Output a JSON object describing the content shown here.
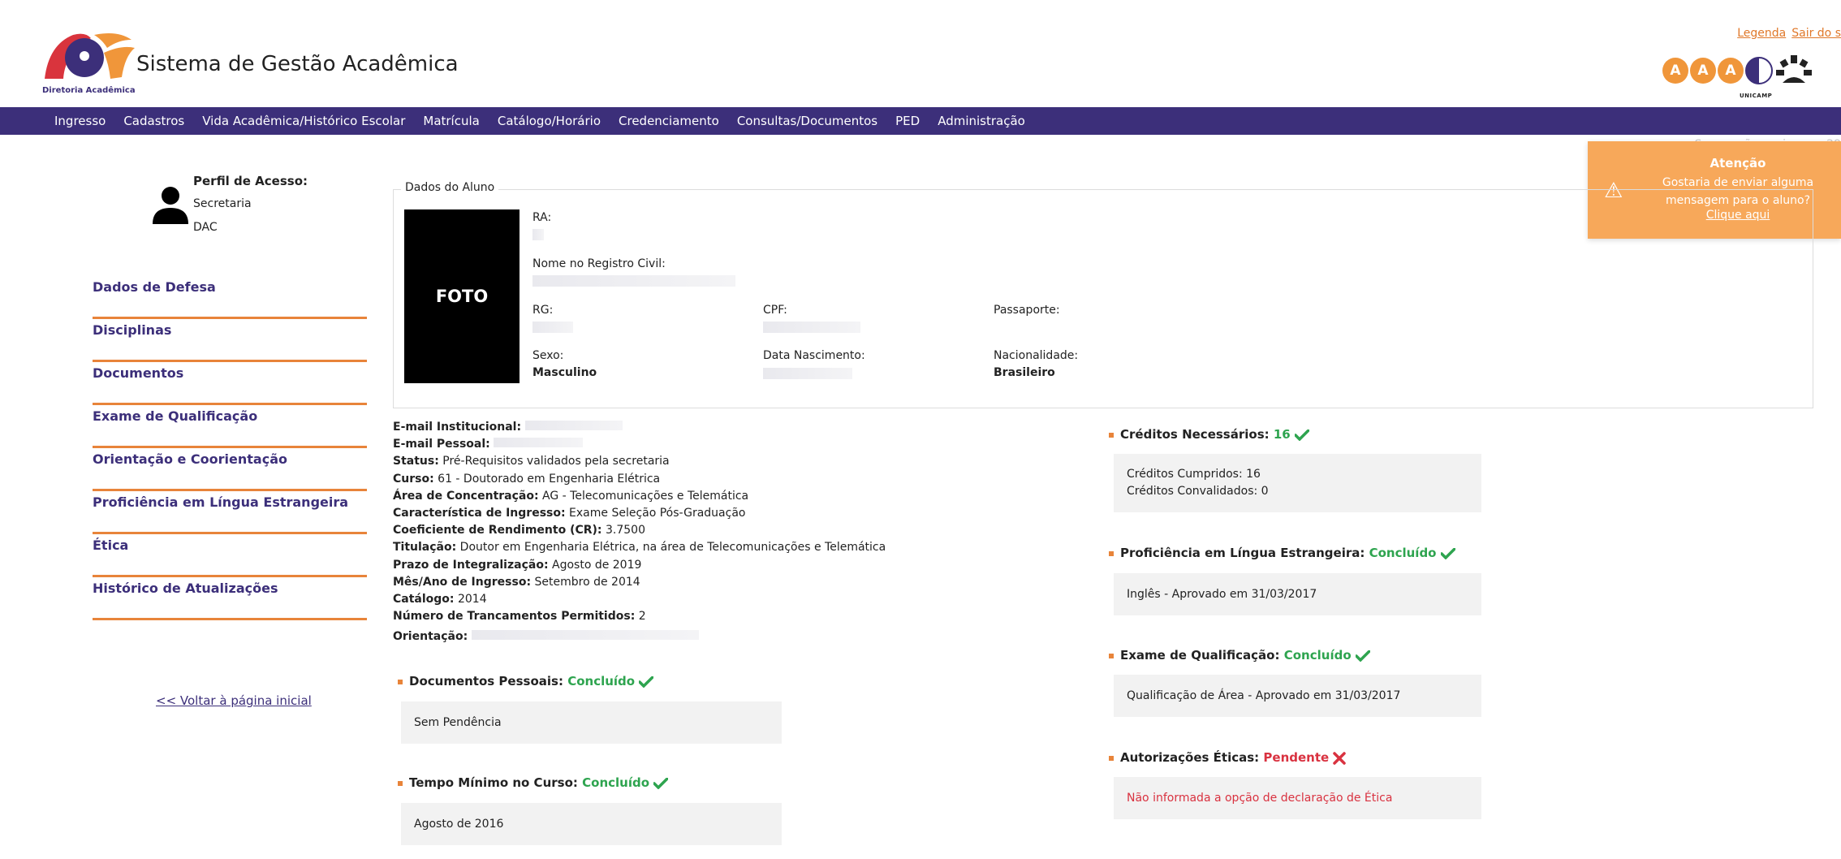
{
  "header": {
    "logo_subtitle": "Diretoria Acadêmica",
    "app_title": "Sistema de Gestão Acadêmica",
    "top_links": [
      "Legenda",
      "Sair do s"
    ],
    "brand_letters": [
      "A",
      "A",
      "A"
    ],
    "brand_name": "UNICAMP"
  },
  "nav": {
    "items": [
      "Ingresso",
      "Cadastros",
      "Vida Acadêmica/Histórico Escolar",
      "Matrícula",
      "Catálogo/Horário",
      "Credenciamento",
      "Consultas/Documentos",
      "PED",
      "Administração"
    ]
  },
  "session": {
    "text": "Sua sessão expira em: 29"
  },
  "toast": {
    "title": "Atenção",
    "message": "Gostaria de enviar alguma mensagem para o aluno?",
    "link": "Clique aqui",
    "color": "#f7a85a"
  },
  "profile": {
    "label": "Perfil de Acesso:",
    "role": "Secretaria",
    "unit": "DAC"
  },
  "sidebar": {
    "items": [
      "Dados de Defesa",
      "Disciplinas",
      "Documentos",
      "Exame de Qualificação",
      "Orientação e Coorientação",
      "Proficiência em Língua Estrangeira",
      "Ética",
      "Histórico de Atualizações"
    ],
    "back_link": "<< Voltar à página inicial"
  },
  "student": {
    "legend": "Dados do Aluno",
    "photo_text": "FOTO",
    "ra_label": "RA:",
    "name_label": "Nome no Registro Civil:",
    "rg_label": "RG:",
    "cpf_label": "CPF:",
    "passport_label": "Passaporte:",
    "sex_label": "Sexo:",
    "sex_value": "Masculino",
    "birth_label": "Data Nascimento:",
    "nationality_label": "Nacionalidade:",
    "nationality_value": "Brasileiro"
  },
  "info": {
    "email_inst_label": "E-mail Institucional:",
    "email_pers_label": "E-mail Pessoal:",
    "status_label": "Status:",
    "status_value": "Pré-Requisitos validados pela secretaria",
    "curso_label": "Curso:",
    "curso_value": "61 - Doutorado em Engenharia Elétrica",
    "area_label": "Área de Concentração:",
    "area_value": "AG - Telecomunicações e Telemática",
    "caract_label": "Característica de Ingresso:",
    "caract_value": "Exame Seleção Pós-Graduação",
    "cr_label": "Coeficiente de Rendimento (CR):",
    "cr_value": "3.7500",
    "titulacao_label": "Titulação:",
    "titulacao_value": "Doutor em Engenharia Elétrica, na área de Telecomunicações e Telemática",
    "prazo_label": "Prazo de Integralização:",
    "prazo_value": "Agosto de 2019",
    "ingresso_label": "Mês/Ano de Ingresso:",
    "ingresso_value": "Setembro de 2014",
    "catalogo_label": "Catálogo:",
    "catalogo_value": "2014",
    "trancamentos_label": "Número de Trancamentos Permitidos:",
    "trancamentos_value": "2",
    "orientacao_label": "Orientação:"
  },
  "status": {
    "creditos": {
      "label": "Créditos Necessários:",
      "value": "16",
      "line1": "Créditos Cumpridos: 16",
      "line2": "Créditos Convalidados: 0"
    },
    "proficiencia": {
      "label": "Proficiência em Língua Estrangeira:",
      "value": "Concluído",
      "text": "Inglês - Aprovado em 31/03/2017"
    },
    "exame": {
      "label": "Exame de Qualificação:",
      "value": "Concluído",
      "text": "Qualificação de Área - Aprovado em 31/03/2017"
    },
    "eticas": {
      "label": "Autorizações Éticas:",
      "value": "Pendente",
      "text": "Não informada a opção de declaração de Ética"
    },
    "documentos": {
      "label": "Documentos Pessoais:",
      "value": "Concluído",
      "text": "Sem Pendência"
    },
    "tempo": {
      "label": "Tempo Mínimo no Curso:",
      "value": "Concluído",
      "text": "Agosto de 2016"
    }
  },
  "colors": {
    "nav_bg": "#3c2f7a",
    "accent_orange": "#e8843a",
    "ok_green": "#2ea44f",
    "error_red": "#d93240"
  }
}
